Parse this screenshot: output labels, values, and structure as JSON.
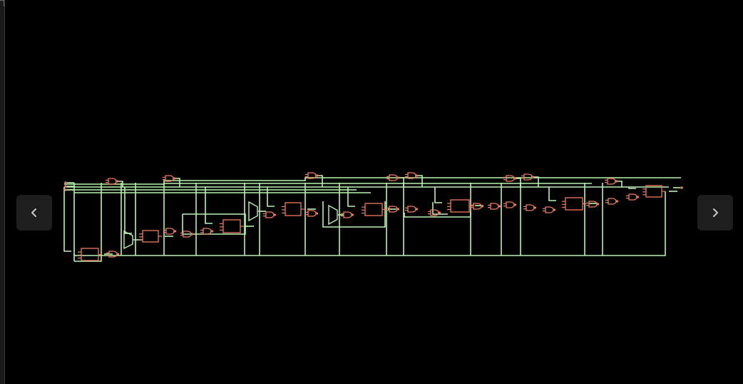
{
  "viewer": {
    "background": "#000000",
    "wire_color": "#b8f2b0",
    "cell_color": "#f07a5e",
    "button_background": "#1e1e1e",
    "button_icon_color": "#c8c8c8"
  },
  "navigation": {
    "prev_icon": "chevron-left-icon",
    "next_icon": "chevron-right-icon"
  }
}
